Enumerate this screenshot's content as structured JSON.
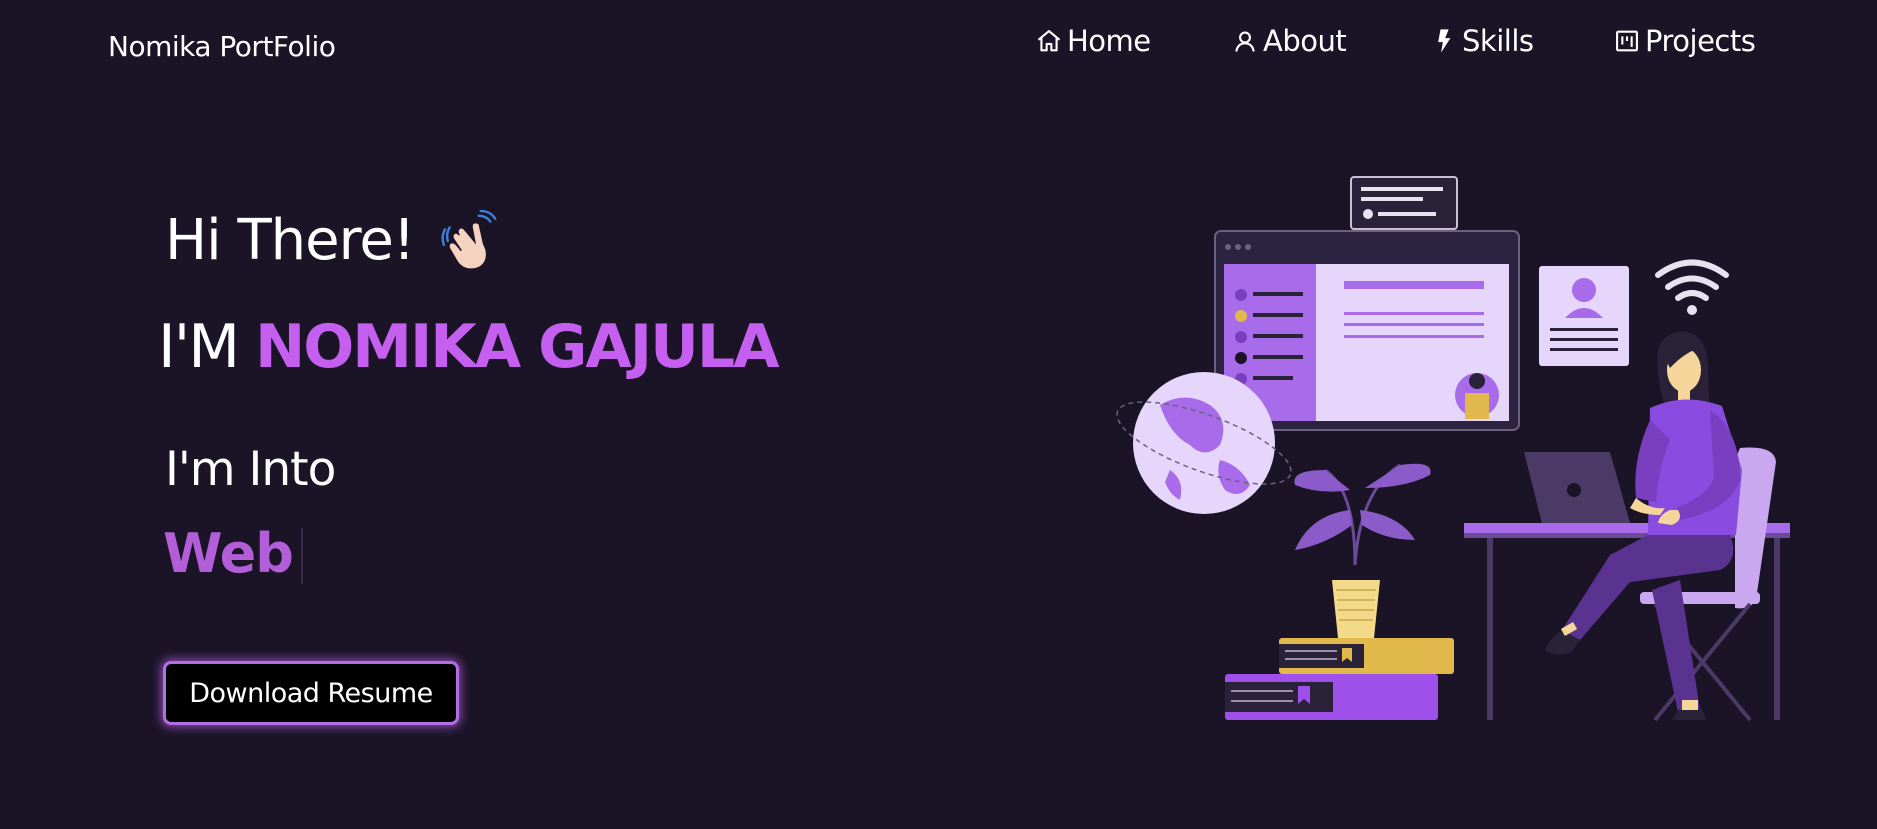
{
  "header": {
    "brand": "Nomika PortFolio",
    "nav": [
      {
        "label": "Home",
        "icon": "home-icon"
      },
      {
        "label": "About",
        "icon": "user-icon"
      },
      {
        "label": "Skills",
        "icon": "bolt-icon"
      },
      {
        "label": "Projects",
        "icon": "kanban-icon"
      }
    ]
  },
  "hero": {
    "greeting": "Hi There!",
    "name_prefix": "I'M",
    "name": "NOMIKA GAJULA",
    "into_label": "I'm Into",
    "typed_word": "Web",
    "resume_button": "Download Resume"
  },
  "colors": {
    "background": "#1a1426",
    "accent": "#c45ff0",
    "typed": "#b25ed8",
    "button_border": "#b36ee6"
  }
}
